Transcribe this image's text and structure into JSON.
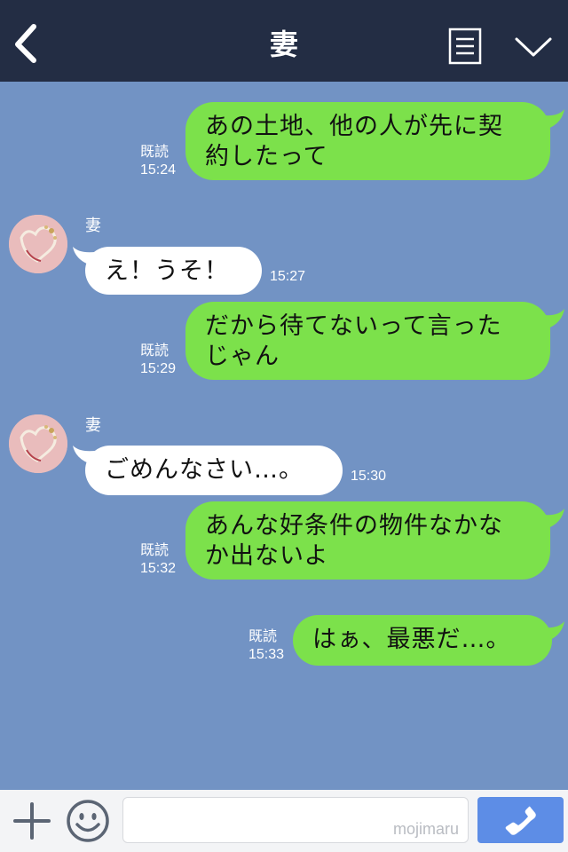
{
  "header": {
    "title": "妻",
    "back_icon": "back-chevron-icon",
    "menu_icon": "menu-list-icon",
    "collapse_icon": "chevron-down-icon",
    "bg_color": "#232d44"
  },
  "chat": {
    "bg_color": "#7293c4",
    "messages": [
      {
        "side": "out",
        "text": "あの土地、他の人が先に契\n約したって",
        "read": "既読",
        "time": "15:24"
      },
      {
        "side": "in",
        "sender": "妻",
        "text": "え！うそ！",
        "time": "15:27"
      },
      {
        "side": "out",
        "text": "だから待てないって言った\nじゃん",
        "read": "既読",
        "time": "15:29"
      },
      {
        "side": "in",
        "sender": "妻",
        "text": "ごめんなさい…。",
        "time": "15:30"
      },
      {
        "side": "out",
        "text": "あんな好条件の物件なかな\nか出ないよ",
        "read": "既読",
        "time": "15:32"
      },
      {
        "side": "out",
        "text": "はぁ、最悪だ…。",
        "read": "既読",
        "time": "15:33"
      }
    ],
    "out_bubble_color": "#7ce14b",
    "in_bubble_color": "#ffffff"
  },
  "footer": {
    "plus_icon": "plus-icon",
    "emoji_icon": "emoji-icon",
    "input_value": "",
    "watermark": "mojimaru",
    "call_icon": "phone-icon",
    "call_color": "#5d8de6"
  }
}
